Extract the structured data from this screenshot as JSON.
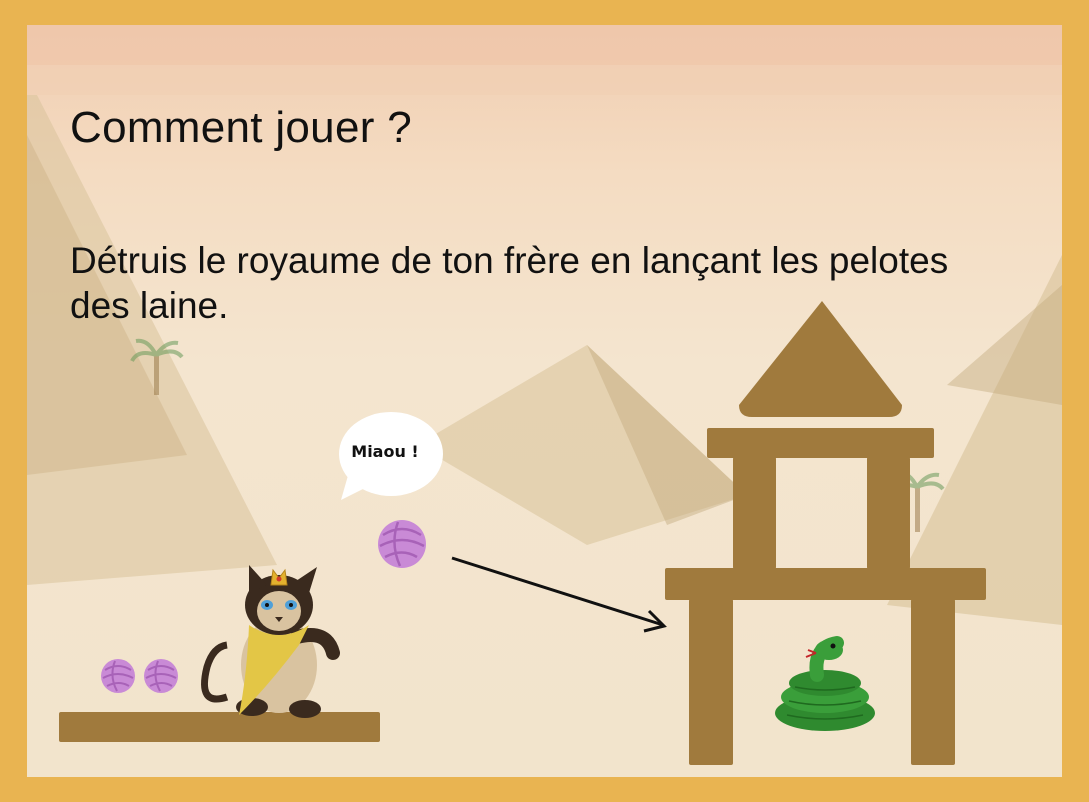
{
  "page": {
    "title": "Comment jouer ?",
    "instructions": "Détruis le royaume de ton frère en lançant les pelotes des laine."
  },
  "speech_bubble": {
    "text": "Miaou !"
  },
  "colors": {
    "frame": "#e9b451",
    "wood": "#a07a3d",
    "yarn": "#c98ad6",
    "snake": "#2f8a2f",
    "sky_top": "#f1cdb1",
    "sand": "#f2e4cc"
  },
  "sprites": {
    "player": "cat-king-icon",
    "target": "snake-icon",
    "projectile": "yarn-ball-icon"
  },
  "ammo": {
    "remaining": 2
  }
}
